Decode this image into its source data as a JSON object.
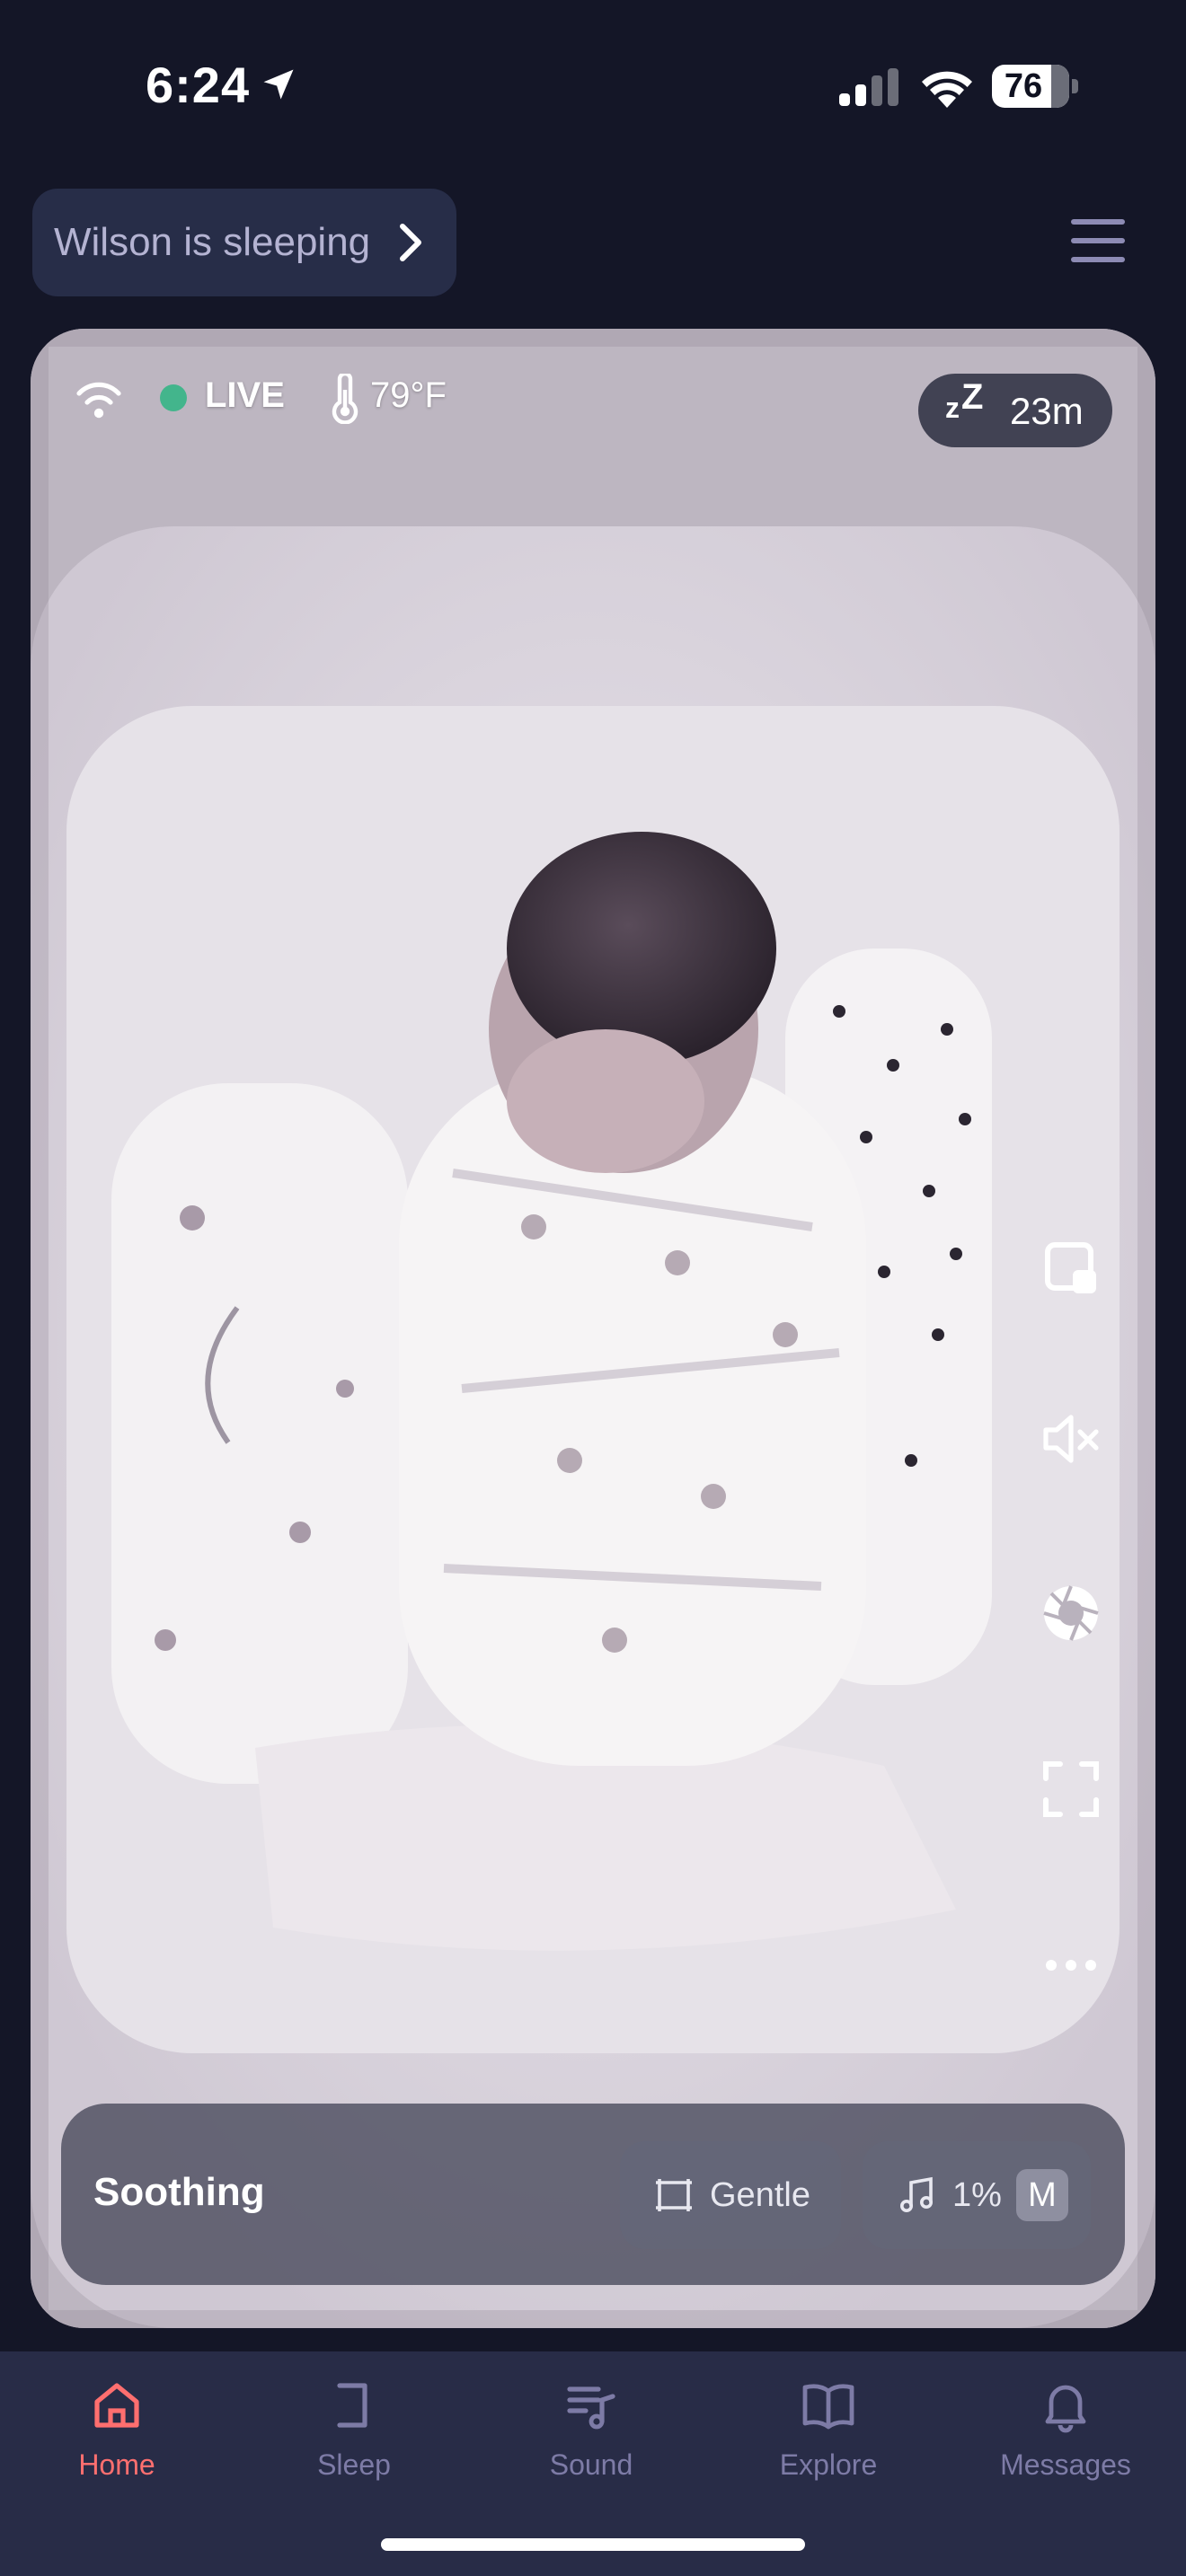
{
  "status_bar": {
    "time": "6:24",
    "battery": "76",
    "icons": [
      "location-arrow-icon",
      "cellular-signal-icon",
      "wifi-icon",
      "battery-icon"
    ]
  },
  "header": {
    "status_chip": "Wilson is sleeping",
    "chip_icon": "chevron-right-icon",
    "menu_icon": "hamburger-menu-icon"
  },
  "camera": {
    "live_label": "LIVE",
    "temperature": "79°F",
    "sleep_duration": "23m",
    "sleep_icon": "zz-sleep-icon",
    "live_color": "#43b58c",
    "side_controls": [
      {
        "name": "picture-in-picture-icon"
      },
      {
        "name": "speaker-muted-icon"
      },
      {
        "name": "camera-shutter-icon"
      },
      {
        "name": "fullscreen-icon"
      },
      {
        "name": "more-options-icon"
      }
    ]
  },
  "soothing": {
    "label": "Soothing",
    "motion_level": "Gentle",
    "volume": "1%",
    "volume_badge": "M"
  },
  "nav": {
    "active_color": "#ff6f6f",
    "inactive_color": "#7d7ba6",
    "items": [
      {
        "label": "Home",
        "icon": "home-icon"
      },
      {
        "label": "Sleep",
        "icon": "sleep-icon"
      },
      {
        "label": "Sound",
        "icon": "sound-icon"
      },
      {
        "label": "Explore",
        "icon": "explore-book-icon"
      },
      {
        "label": "Messages",
        "icon": "bell-icon"
      }
    ]
  }
}
